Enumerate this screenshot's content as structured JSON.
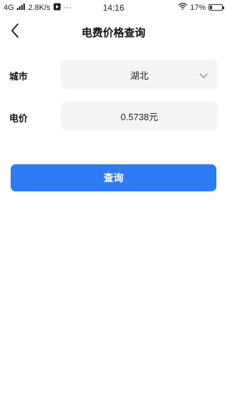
{
  "status_bar": {
    "network": "4G",
    "speed": "2.8K/s",
    "more": "···",
    "time": "14:16",
    "battery_percent": "17%",
    "battery_level": 0.17
  },
  "header": {
    "title": "电费价格查询",
    "back_icon": "chevron-left-icon"
  },
  "form": {
    "city": {
      "label": "城市",
      "value": "湖北",
      "icon": "chevron-down-icon"
    },
    "price": {
      "label": "电价",
      "value": "0.5738元"
    }
  },
  "actions": {
    "query_label": "查询"
  },
  "colors": {
    "accent": "#2e7bf6",
    "field_bg": "#f5f5f7"
  }
}
